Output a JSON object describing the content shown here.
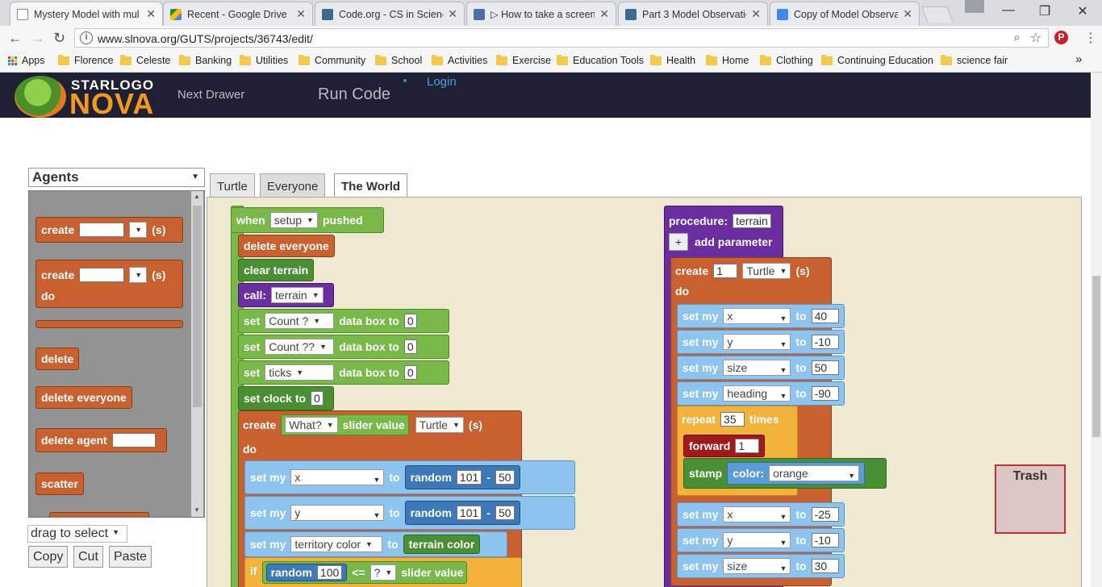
{
  "browser": {
    "tabs": [
      {
        "title": "Mystery Model with mul"
      },
      {
        "title": "Recent - Google Drive"
      },
      {
        "title": "Code.org - CS in Science"
      },
      {
        "title": "▷ How to take a screens"
      },
      {
        "title": "Part 3 Model Observatio"
      },
      {
        "title": "Copy of Model Observa"
      }
    ],
    "url": "www.slnova.org/GUTS/projects/36743/edit/",
    "bookmarks": [
      "Apps",
      "Florence",
      "Celeste",
      "Banking",
      "Utilities",
      "Community",
      "School",
      "Activities",
      "Exercise",
      "Education Tools",
      "Health",
      "Home",
      "Clothing",
      "Continuing Education",
      "science fair"
    ],
    "more": "»"
  },
  "app": {
    "logo_top": "STARLOGO",
    "logo_bottom": "NOVA",
    "next_drawer": "Next Drawer",
    "run_code": "Run Code",
    "login": "Login"
  },
  "palette": {
    "agent": "Agents",
    "blocks": {
      "create": "create",
      "create_suffix": "(s)",
      "do": "do",
      "delete": "delete",
      "delete_everyone": "delete everyone",
      "delete_agent": "delete agent",
      "scatter": "scatter"
    },
    "select_mode": "drag to select",
    "copy": "Copy",
    "cut": "Cut",
    "paste": "Paste"
  },
  "tabs": [
    "Turtle",
    "Everyone",
    "The World"
  ],
  "setup": {
    "when": "when",
    "setup": "setup",
    "pushed": "pushed",
    "delete_everyone": "delete everyone",
    "clear_terrain": "clear terrain",
    "call": "call:",
    "terrain": "terrain",
    "set": "set",
    "data_box_to": "data box to",
    "box1": "Count ?",
    "box2": "Count ??",
    "box3": "ticks",
    "val": "0",
    "set_clock_to": "set clock to",
    "clock": "0",
    "create": "create",
    "what": "What?",
    "slider_value": "slider value",
    "turtle": "Turtle",
    "s": "(s)",
    "do": "do",
    "set_my": "set my",
    "to": "to",
    "x": "x",
    "y": "y",
    "random": "random",
    "r101": "101",
    "minus": "-",
    "m50": "50",
    "territory_color": "territory color",
    "terrain_color": "terrain color",
    "if": "if",
    "r100": "100",
    "lte": "<=",
    "q": "?"
  },
  "procedure": {
    "label": "procedure:",
    "name": "terrain",
    "plus": "+",
    "add_parameter": "add parameter",
    "create": "create",
    "count": "1",
    "turtle": "Turtle",
    "s": "(s)",
    "do": "do",
    "set_my": "set my",
    "to": "to",
    "rows1": [
      {
        "prop": "x",
        "val": "40"
      },
      {
        "prop": "y",
        "val": "-10"
      },
      {
        "prop": "size",
        "val": "50"
      },
      {
        "prop": "heading",
        "val": "-90"
      }
    ],
    "repeat": "repeat",
    "times_val": "35",
    "times": "times",
    "forward": "forward",
    "fwd_val": "1",
    "stamp": "stamp",
    "color": "color:",
    "color_val": "orange",
    "rows2": [
      {
        "prop": "x",
        "val": "-25"
      },
      {
        "prop": "y",
        "val": "-10"
      },
      {
        "prop": "size",
        "val": "30"
      }
    ]
  },
  "trash": "Trash",
  "colors": {
    "header": "#1f2033",
    "workspace": "#efe9d2",
    "orange_block": "#c8602f",
    "green_block": "#78b94a",
    "purple_block": "#6b2ea1",
    "blue_block": "#5b9bd8",
    "yellow_block": "#f3b23c"
  }
}
